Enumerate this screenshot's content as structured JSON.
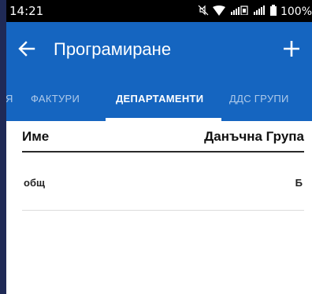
{
  "status_bar": {
    "time": "14:21",
    "battery_text": "100%",
    "icons": [
      "mute-icon",
      "wifi-icon",
      "signal-icon",
      "signal-icon",
      "battery-icon"
    ]
  },
  "toolbar": {
    "title": "Програмиране"
  },
  "tabs": [
    {
      "label": "Я",
      "active": false
    },
    {
      "label": "ФАКТУРИ",
      "active": false
    },
    {
      "label": "ДЕПАРТАМЕНТИ",
      "active": true
    },
    {
      "label": "ДДС ГРУПИ",
      "active": false
    }
  ],
  "table": {
    "headers": {
      "name": "Име",
      "tax_group": "Данъчна Група"
    },
    "rows": [
      {
        "name": "общ",
        "tax_group": "Б"
      }
    ]
  },
  "colors": {
    "app_bar": "#1565c0",
    "status_bar": "#000000",
    "frame": "#1f2a56"
  }
}
